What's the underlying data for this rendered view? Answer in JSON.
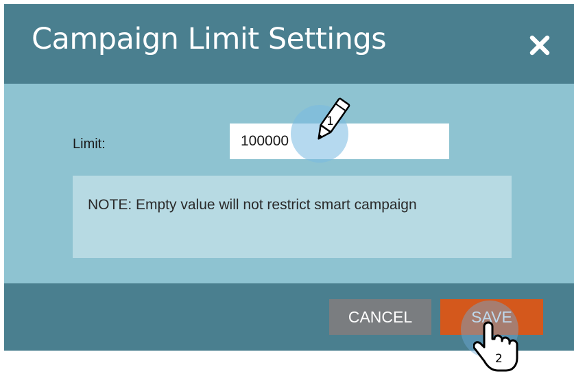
{
  "dialog": {
    "title": "Campaign Limit Settings",
    "close_icon": "close-icon"
  },
  "form": {
    "limit_label": "Limit:",
    "limit_value": "100000",
    "note": "NOTE: Empty value will not restrict smart campaign"
  },
  "footer": {
    "cancel_label": "CANCEL",
    "save_label": "SAVE"
  },
  "annotations": {
    "step1_number": "1",
    "step2_number": "2",
    "step1_icon": "pencil-icon",
    "step2_icon": "hand-pointer-icon"
  },
  "colors": {
    "header": "#4a7f8f",
    "body": "#8ec3d1",
    "note": "#b7dae3",
    "cancel": "#7a7d80",
    "save": "#d4581c"
  }
}
